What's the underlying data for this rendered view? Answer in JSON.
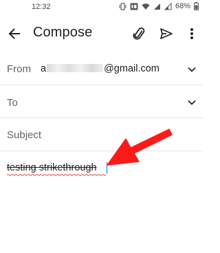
{
  "status_bar": {
    "time": "12:32",
    "battery": "68%"
  },
  "toolbar": {
    "title": "Compose",
    "back_icon": "arrow-back-icon",
    "attach_icon": "paperclip-icon",
    "send_icon": "send-icon",
    "more_icon": "more-vert-icon"
  },
  "from": {
    "label": "From",
    "value_lead": "a",
    "value_domain": "@gmail.com"
  },
  "to": {
    "label": "To"
  },
  "subject": {
    "placeholder": "Subject"
  },
  "body": {
    "text": "testing strikethrough"
  },
  "colors": {
    "annotation_red": "#ff1a1a",
    "spellcheck_red": "#e53935",
    "caret_blue": "#1a73e8"
  }
}
